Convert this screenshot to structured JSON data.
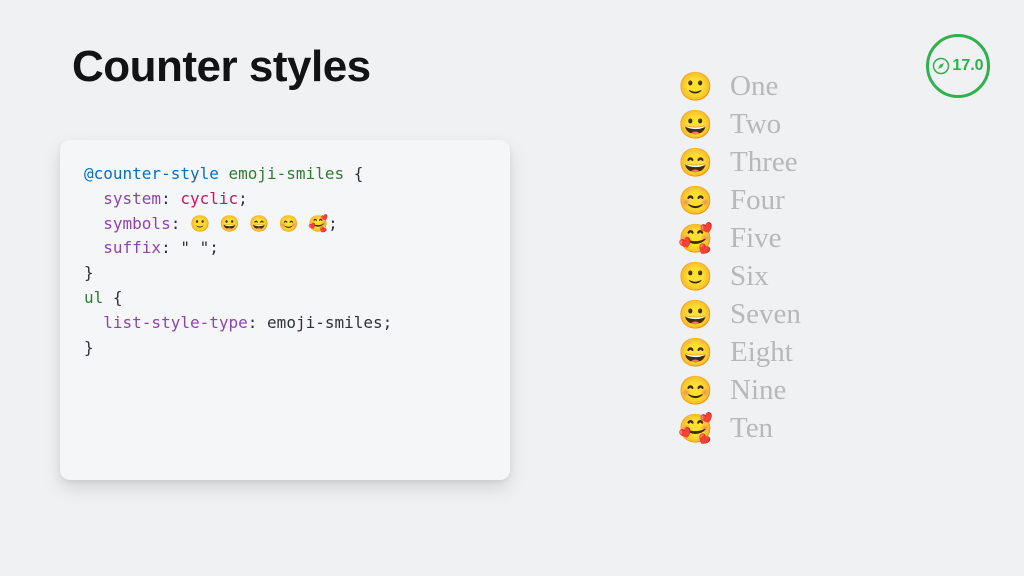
{
  "title": "Counter styles",
  "badge": {
    "version": "17.0"
  },
  "code": {
    "rule": "@counter-style",
    "name": "emoji-smiles",
    "brace_open": "{",
    "brace_close": "}",
    "system_prop": "system",
    "system_val": "cyclic",
    "symbols_prop": "symbols",
    "symbols_val": "🙂 😀 😄 😊 🥰",
    "suffix_prop": "suffix",
    "suffix_val": "\" \"",
    "sel": "ul",
    "lst_prop": "list-style-type",
    "lst_val": "emoji-smiles",
    "colon": ":",
    "semicolon": ";"
  },
  "list": [
    {
      "marker": "🙂",
      "label": "One"
    },
    {
      "marker": "😀",
      "label": "Two"
    },
    {
      "marker": "😄",
      "label": "Three"
    },
    {
      "marker": "😊",
      "label": "Four"
    },
    {
      "marker": "🥰",
      "label": "Five"
    },
    {
      "marker": "🙂",
      "label": "Six"
    },
    {
      "marker": "😀",
      "label": "Seven"
    },
    {
      "marker": "😄",
      "label": "Eight"
    },
    {
      "marker": "😊",
      "label": "Nine"
    },
    {
      "marker": "🥰",
      "label": "Ten"
    }
  ]
}
